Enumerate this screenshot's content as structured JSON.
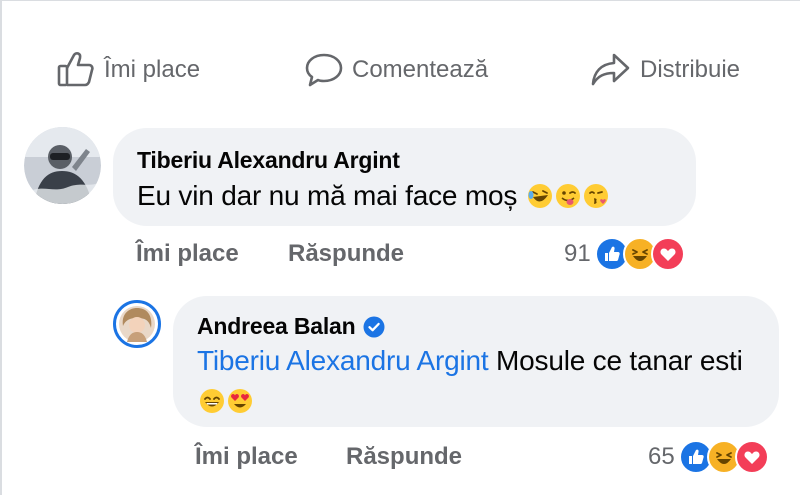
{
  "actions": {
    "like_label": "Îmi place",
    "comment_label": "Comentează",
    "share_label": "Distribuie"
  },
  "comments": [
    {
      "author": "Tiberiu Alexandru Argint",
      "text": "Eu vin dar nu mă mai face moș",
      "emojis": [
        "rolling-on-floor-laughing",
        "winking-face-with-tongue",
        "face-blowing-kiss"
      ],
      "like_label": "Îmi place",
      "reply_label": "Răspunde",
      "reaction_count": "91",
      "reactions": [
        "like",
        "haha",
        "love"
      ]
    },
    {
      "author": "Andreea Balan",
      "verified": true,
      "mention": "Tiberiu Alexandru Argint",
      "text": " Mosule ce tanar esti",
      "emojis": [
        "grinning-face-with-smiling-eyes",
        "smiling-face-with-heart-eyes"
      ],
      "like_label": "Îmi place",
      "reply_label": "Răspunde",
      "reaction_count": "65",
      "reactions": [
        "like",
        "haha",
        "love"
      ]
    }
  ],
  "colors": {
    "accent": "#1b74e4",
    "bubble": "#f0f2f5",
    "secondary_text": "#65676b",
    "love": "#f33e58",
    "haha": "#f7b125"
  }
}
